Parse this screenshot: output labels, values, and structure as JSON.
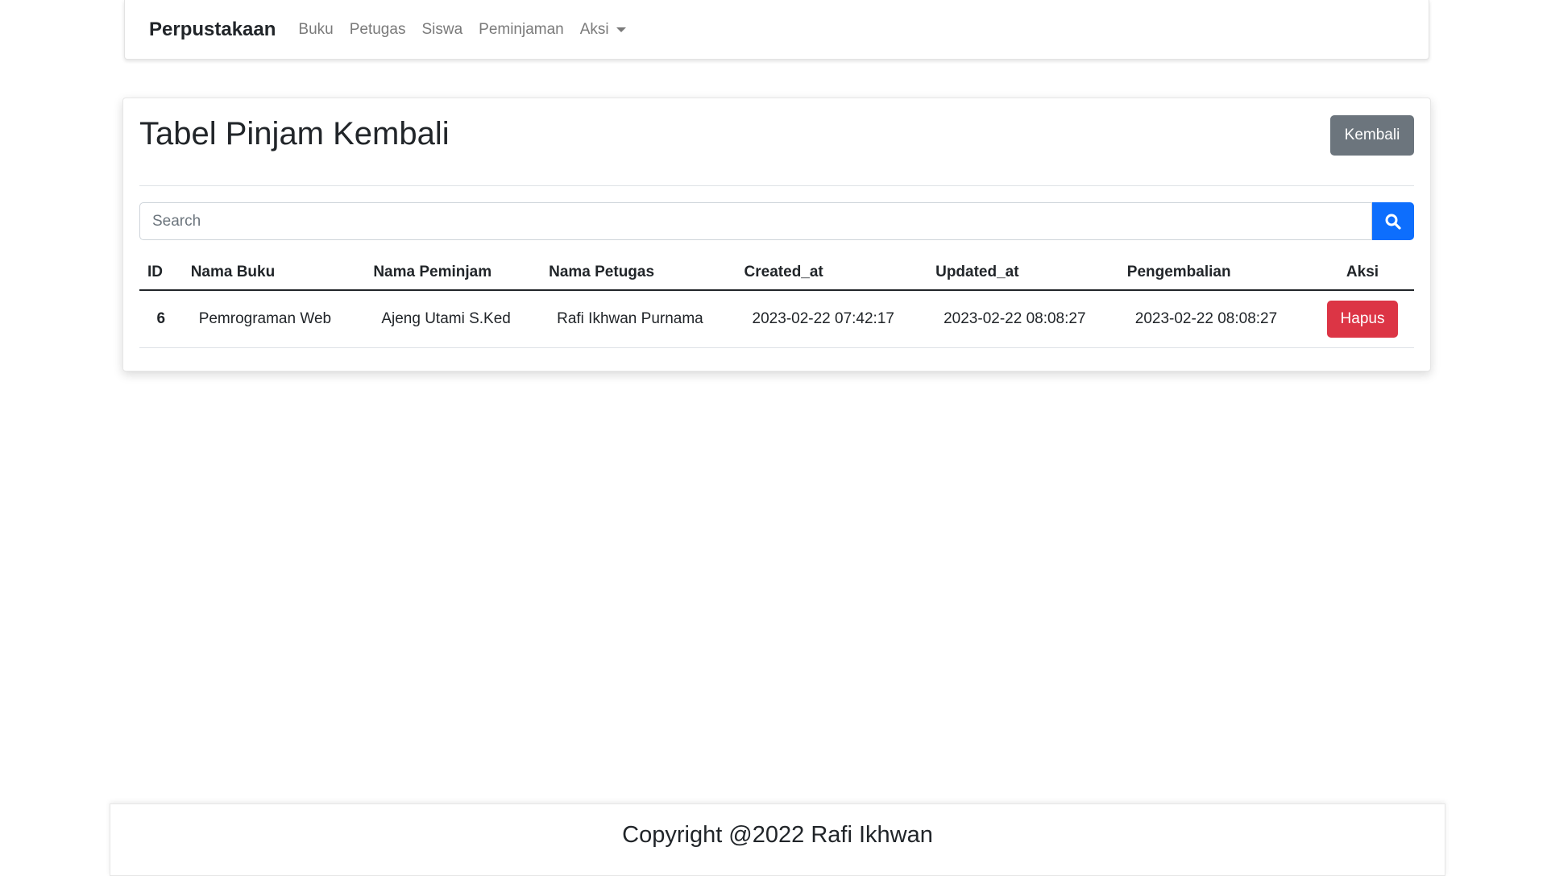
{
  "navbar": {
    "brand": "Perpustakaan",
    "items": [
      {
        "label": "Buku"
      },
      {
        "label": "Petugas"
      },
      {
        "label": "Siswa"
      },
      {
        "label": "Peminjaman"
      },
      {
        "label": "Aksi",
        "has_dropdown": true
      }
    ]
  },
  "main": {
    "title": "Tabel Pinjam Kembali",
    "back_button": "Kembali",
    "search": {
      "placeholder": "Search",
      "value": "",
      "button_icon": "search-icon"
    },
    "table": {
      "columns": [
        "ID",
        "Nama Buku",
        "Nama Peminjam",
        "Nama Petugas",
        "Created_at",
        "Updated_at",
        "Pengembalian",
        "Aksi"
      ],
      "rows": [
        {
          "id": "6",
          "nama_buku": "Pemrograman Web",
          "nama_peminjam": "Ajeng Utami S.Ked",
          "nama_petugas": "Rafi Ikhwan Purnama",
          "created_at": "2023-02-22 07:42:17",
          "updated_at": "2023-02-22 08:08:27",
          "pengembalian": "2023-02-22 08:08:27",
          "action": "Hapus"
        }
      ]
    }
  },
  "footer": {
    "text": "Copyright @2022 Rafi Ikhwan"
  },
  "colors": {
    "primary": "#0d6efd",
    "secondary": "#6c757d",
    "danger": "#dc3545",
    "text": "#212529",
    "nav_text": "#7a7a7a"
  }
}
